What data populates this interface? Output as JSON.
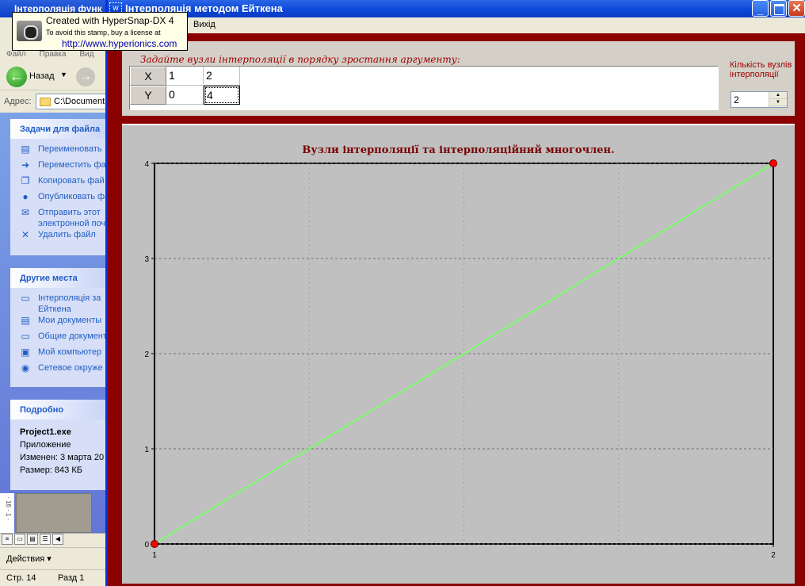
{
  "explorer": {
    "title": "Інтерполяція функ",
    "menu": [
      "Файл",
      "Правка",
      "Вид"
    ],
    "back_label": "Назад",
    "address_label": "Адрес:",
    "address_value": "C:\\Document",
    "tasks_header": "Задачи для файла",
    "tasks": [
      {
        "icon": "rename-icon",
        "glyph": "▤",
        "label": "Переименовать"
      },
      {
        "icon": "move-icon",
        "glyph": "➜",
        "label": "Переместить фа"
      },
      {
        "icon": "copy-icon",
        "glyph": "❐",
        "label": "Копировать фай"
      },
      {
        "icon": "publish-icon",
        "glyph": "●",
        "label": "Опубликовать фа"
      },
      {
        "icon": "email-icon",
        "glyph": "✉",
        "label": "Отправить этот электронной поч"
      },
      {
        "icon": "delete-icon",
        "glyph": "✕",
        "label": "Удалить файл"
      }
    ],
    "places_header": "Другие места",
    "places": [
      {
        "icon": "folder-icon",
        "glyph": "▭",
        "label": "Інтерполяція за Ейткена"
      },
      {
        "icon": "documents-icon",
        "glyph": "▤",
        "label": "Мои документы"
      },
      {
        "icon": "folder-icon",
        "glyph": "▭",
        "label": "Общие документ"
      },
      {
        "icon": "computer-icon",
        "glyph": "▣",
        "label": "Мой компьютер"
      },
      {
        "icon": "network-icon",
        "glyph": "◉",
        "label": "Сетевое окруже"
      }
    ],
    "details_header": "Подробно",
    "details": {
      "name": "Project1.exe",
      "type": "Приложение",
      "modified": "Изменен: 3 марта 20",
      "size": "Размер: 843 КБ"
    },
    "ruler_text": "· 16 · 1 ·",
    "actions_label": "Действия ▾",
    "status_page": "Стр.  14",
    "status_section": "Разд  1"
  },
  "stamp": {
    "line1": "Created with HyperSnap-DX 4",
    "line2": "To avoid this stamp, buy a license at",
    "line3": "http://www.hyperionics.com"
  },
  "app": {
    "title": "Інтерполяція методом Ейткена",
    "title_icon": "w",
    "menu_exit": "Вихід",
    "hint": "Задайте вузли інтерполяції в порядку зростання аргументу:",
    "row_x_label": "X",
    "row_y_label": "Y",
    "x_values": [
      "1",
      "2"
    ],
    "y_values": [
      "0",
      "4"
    ],
    "count_label": "Кількість вузлів інтерполяції",
    "count_value": "2",
    "colors": {
      "frame": "#8b0000",
      "curve": "#7cfc6c",
      "node": "#ff0000"
    }
  },
  "chart_data": {
    "type": "line",
    "title": "Вузли інтерполяції  та інтерполяційний многочлен.",
    "xlim": [
      1,
      2
    ],
    "ylim": [
      0,
      4
    ],
    "xticks": [
      "1",
      "2"
    ],
    "yticks": [
      "0",
      "1",
      "2",
      "3",
      "4"
    ],
    "grid": true,
    "series": [
      {
        "x": [
          1,
          2
        ],
        "y": [
          0,
          4
        ],
        "color": "#7cfc6c"
      }
    ],
    "nodes": {
      "x": [
        1,
        2
      ],
      "y": [
        0,
        4
      ],
      "color": "#ff0000"
    }
  }
}
